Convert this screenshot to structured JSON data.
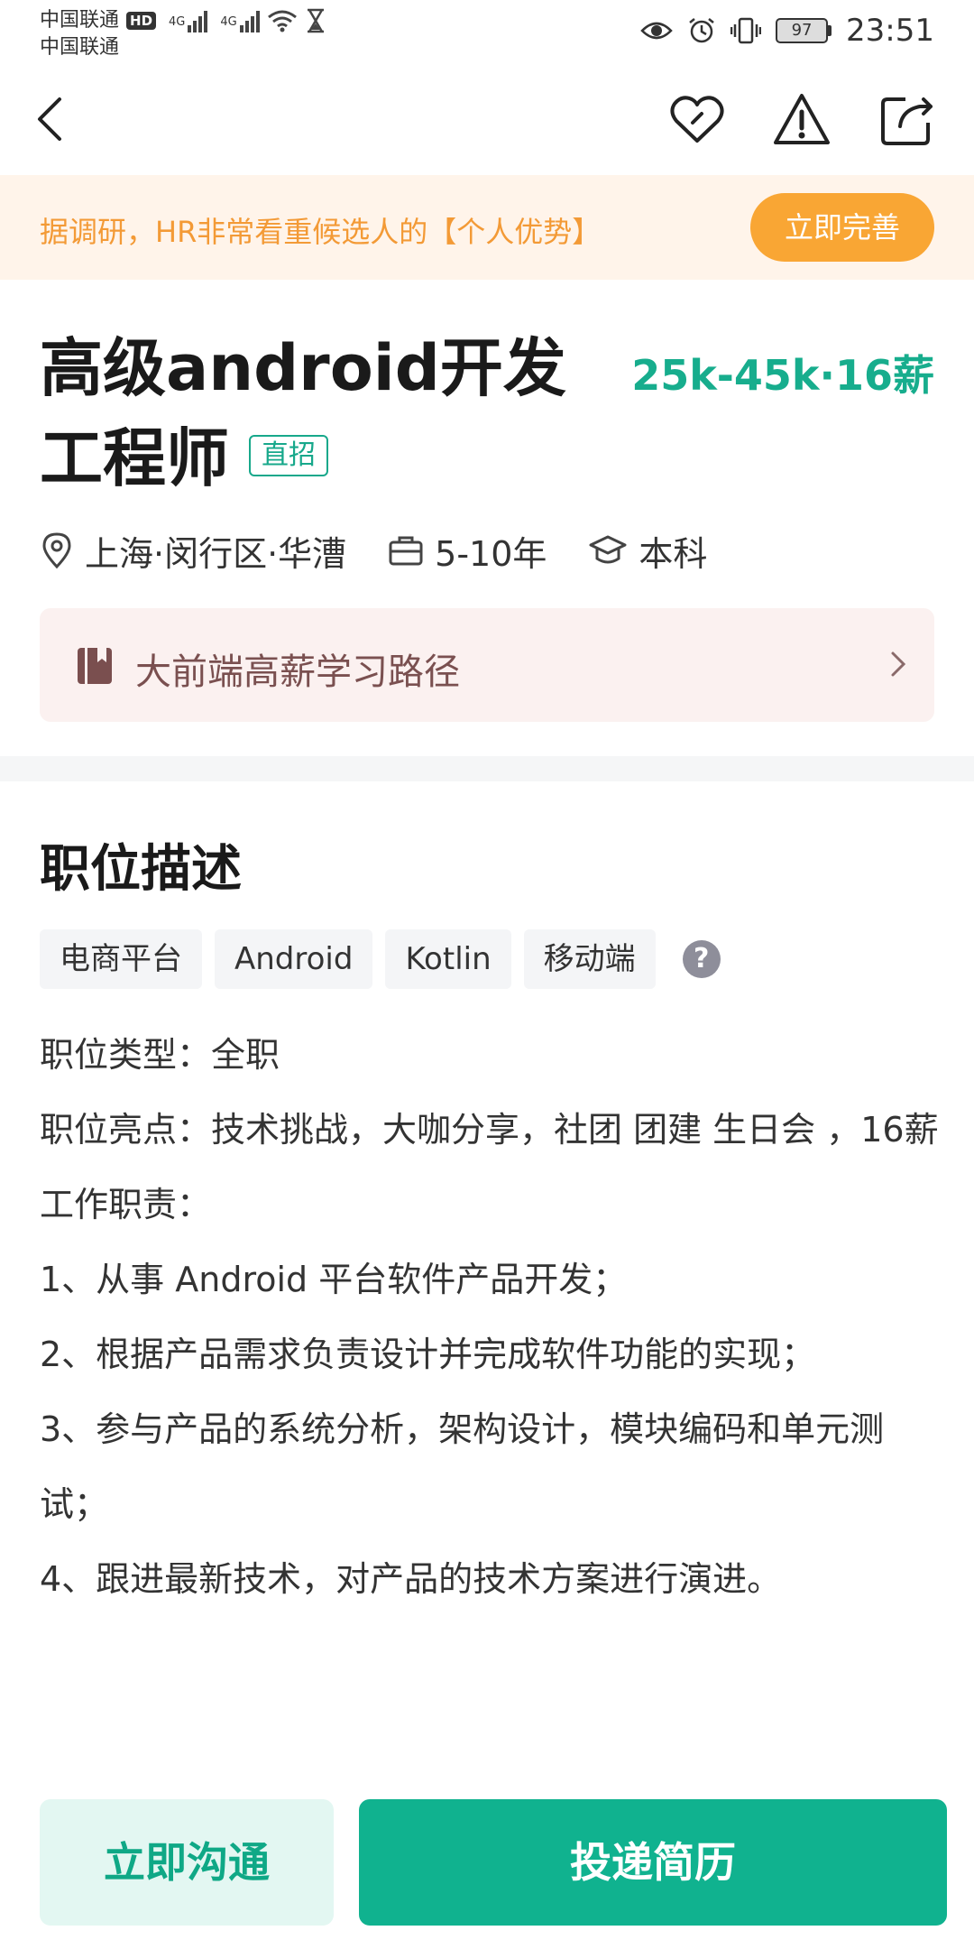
{
  "status": {
    "carrier1": "中国联通",
    "carrier2": "中国联通",
    "hd": "HD",
    "net1": "4G",
    "net2": "4G",
    "battery": "97",
    "time": "23:51"
  },
  "promo": {
    "text": "据调研，HR非常看重候选人的【个人优势】",
    "button": "立即完善"
  },
  "job": {
    "title": "高级android开发工程师",
    "direct_tag": "直招",
    "salary": "25k-45k·16薪",
    "location": "上海·闵行区·华漕",
    "experience": "5-10年",
    "education": "本科"
  },
  "learning": {
    "label": "大前端高薪学习路径"
  },
  "section": {
    "title": "职位描述"
  },
  "tags": [
    "电商平台",
    "Android",
    "Kotlin",
    "移动端"
  ],
  "help_icon": "?",
  "description": {
    "lines": [
      "职位类型：全职",
      "职位亮点：技术挑战，大咖分享，社团 团建 生日会 ，16薪",
      "工作职责：",
      "1、从事 Android 平台软件产品开发；",
      "2、根据产品需求负责设计并完成软件功能的实现；",
      "3、参与产品的系统分析，架构设计，模块编码和单元测试；",
      "4、跟进最新技术，对产品的技术方案进行演进。"
    ]
  },
  "actions": {
    "chat": "立即沟通",
    "apply": "投递简历"
  },
  "colors": {
    "accent": "#10b28f",
    "salary": "#17ad8d",
    "promo_text": "#f39a36",
    "promo_button": "#f9a634"
  }
}
